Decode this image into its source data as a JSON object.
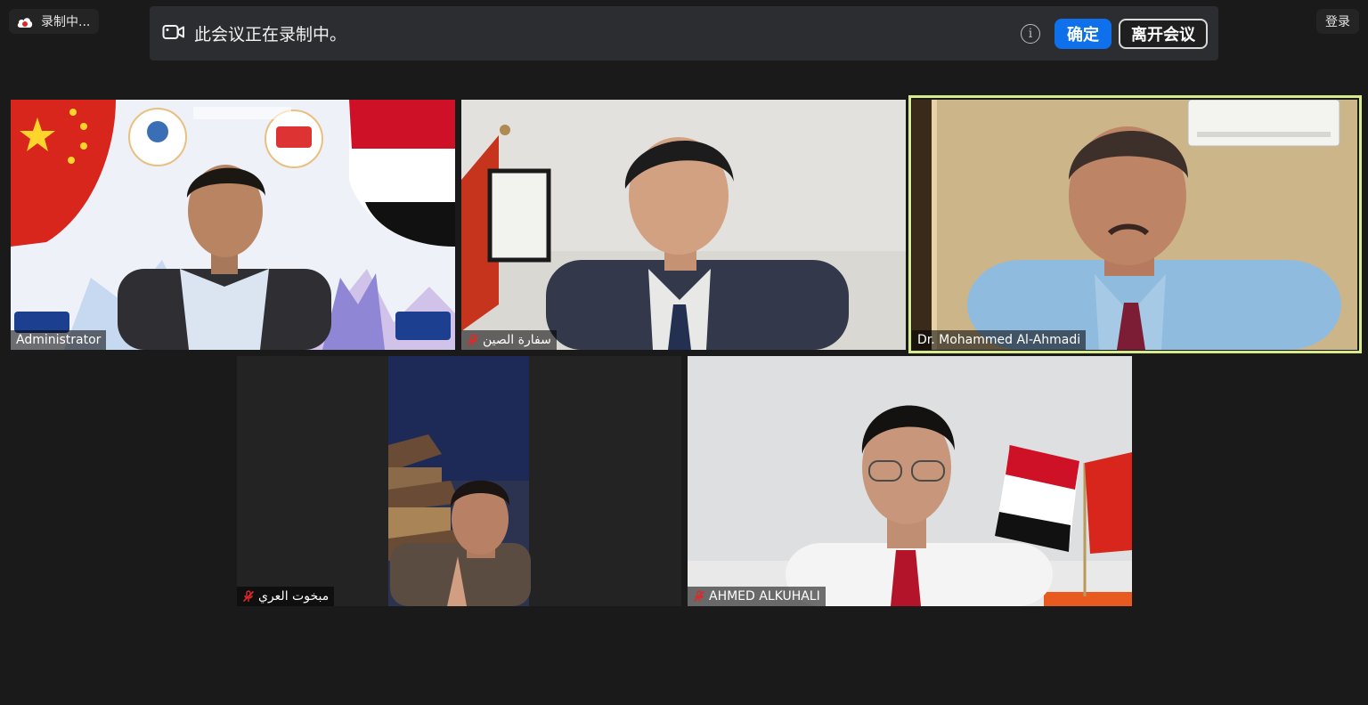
{
  "recording": {
    "label": "录制中..."
  },
  "login": {
    "label": "登录"
  },
  "banner": {
    "message": "此会议正在录制中。",
    "ok_label": "确定",
    "leave_label": "离开会议"
  },
  "participants": [
    {
      "name": "Administrator",
      "muted": false,
      "active": false
    },
    {
      "name": "سفارة الصين",
      "muted": true,
      "active": false
    },
    {
      "name": "Dr. Mohammed Al-Ahmadi",
      "muted": false,
      "active": true
    },
    {
      "name": "مبخوت العري",
      "muted": true,
      "active": false
    },
    {
      "name": "AHMED ALKUHALI",
      "muted": true,
      "active": false
    }
  ],
  "colors": {
    "record_red": "#e02828",
    "primary_blue": "#0e71eb",
    "active_speaker": "#d7ea8c",
    "mute_red": "#e02828"
  }
}
